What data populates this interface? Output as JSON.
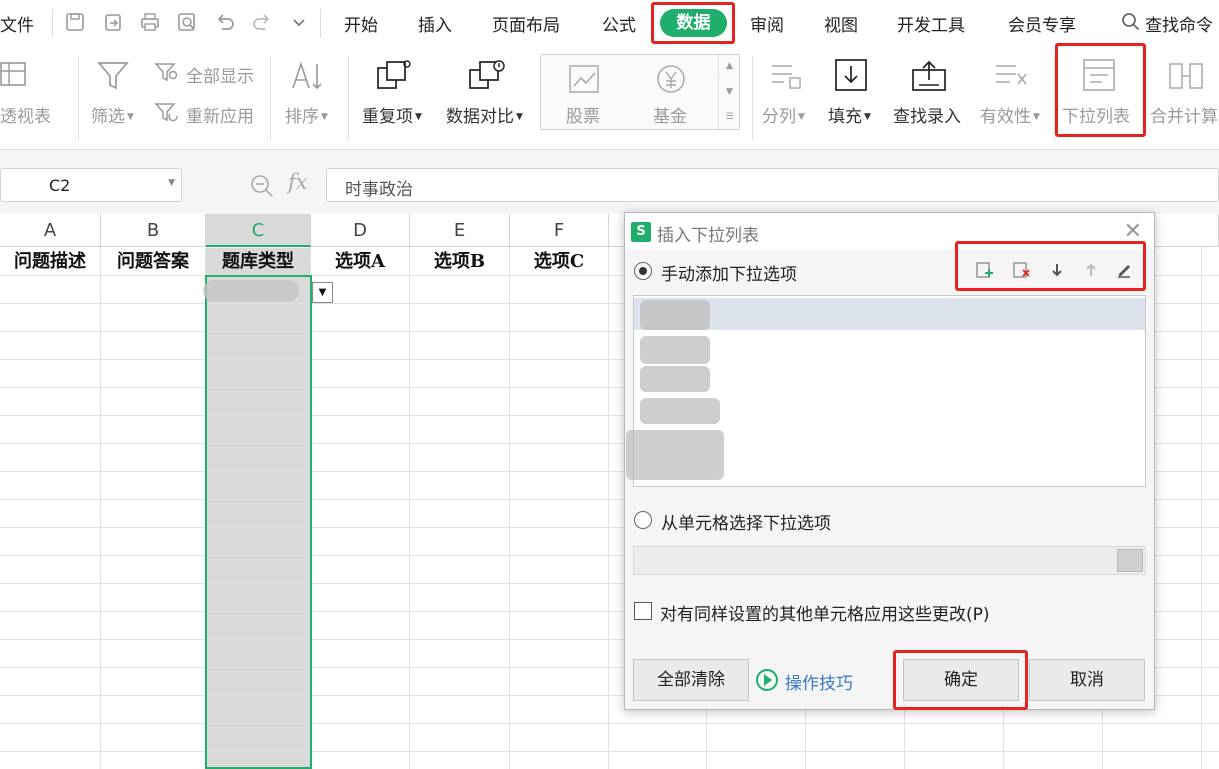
{
  "menu": {
    "file": "文件",
    "tabs": [
      "开始",
      "插入",
      "页面布局",
      "公式",
      "数据",
      "审阅",
      "视图",
      "开发工具",
      "会员专享"
    ],
    "active_tab": "数据",
    "search": "查找命令"
  },
  "ribbon": {
    "pivot": "透视表",
    "filter": "筛选",
    "show_all": "全部显示",
    "reapply": "重新应用",
    "sort": "排序",
    "duplicates": "重复项",
    "compare": "数据对比",
    "stock": "股票",
    "fund": "基金",
    "split": "分列",
    "fill": "填充",
    "lookup": "查找录入",
    "validity": "有效性",
    "dropdown": "下拉列表",
    "consolidate": "合并计算"
  },
  "formula_bar": {
    "cell_ref": "C2",
    "fx": "fx",
    "value": "时事政治"
  },
  "sheet": {
    "columns": [
      "A",
      "B",
      "C",
      "D",
      "E",
      "F"
    ],
    "selected_column": "C",
    "headers": [
      "问题描述",
      "问题答案",
      "题库类型",
      "选项A",
      "选项B",
      "选项C"
    ]
  },
  "dialog": {
    "title": "插入下拉列表",
    "manual_option": "手动添加下拉选项",
    "cell_option": "从单元格选择下拉选项",
    "apply_checkbox": "对有同样设置的其他单元格应用这些更改(P)",
    "clear_all": "全部清除",
    "tips": "操作技巧",
    "ok": "确定",
    "cancel": "取消",
    "logo": "S"
  },
  "colors": {
    "accent": "#1fae6b",
    "highlight_box": "#e8231d",
    "link": "#3a78c7"
  }
}
